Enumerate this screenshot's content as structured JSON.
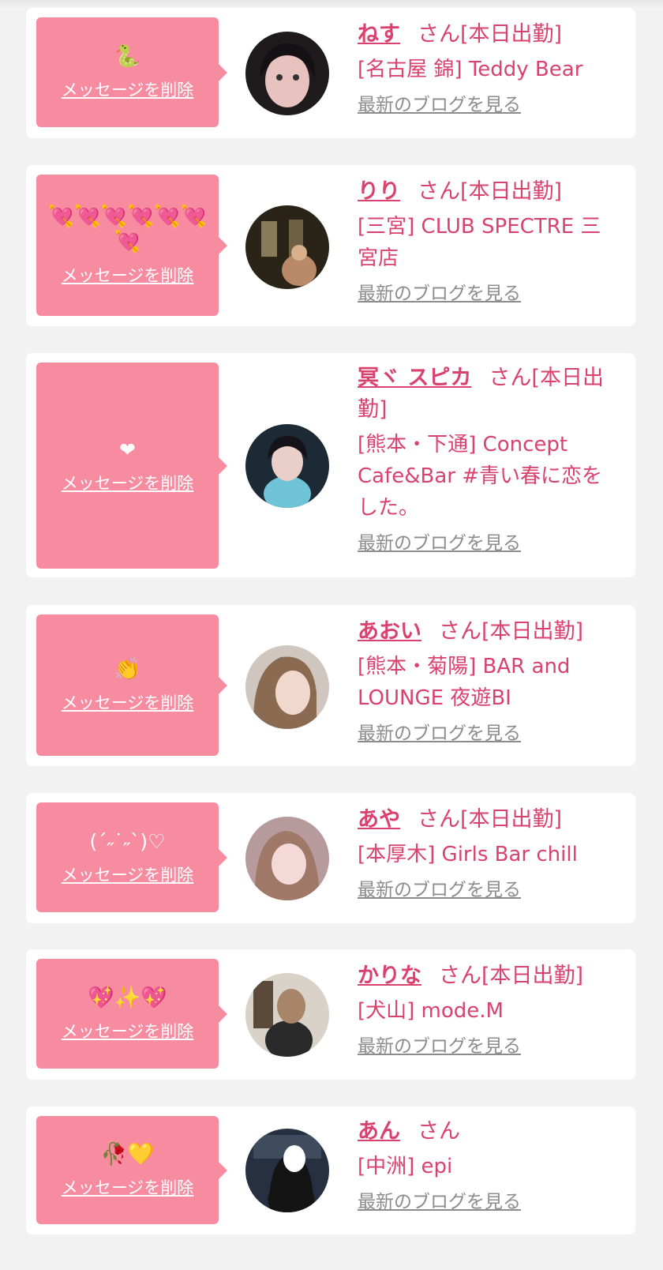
{
  "delete_label": "メッセージを削除",
  "blog_label": "最新のブログを見る",
  "colors": {
    "accent": "#d9426e",
    "bubble": "#f78ba0",
    "blog": "#8c8c8c",
    "background": "#f2f2f2"
  },
  "entries": [
    {
      "message": "🐍",
      "name": "ねす",
      "suffix": "さん[本日出勤]",
      "shop": "[名古屋 錦] Teddy Bear"
    },
    {
      "message": "💘💘💘💘💘💘💘",
      "name": "りり",
      "suffix": "さん[本日出勤]",
      "shop": "[三宮] CLUB SPECTRE 三宮店"
    },
    {
      "message": "❤",
      "name": "冥ヾ スピカ",
      "suffix": "さん[本日出勤]",
      "shop": "[熊本・下通] Concept Cafe&Bar #青い春に恋をした。"
    },
    {
      "message": "👏",
      "name": "あおい",
      "suffix": "さん[本日出勤]",
      "shop": "[熊本・菊陽] BAR and LOUNGE 夜遊BI"
    },
    {
      "message": "(ˊ˶˙˶ˋ)♡",
      "name": "あや",
      "suffix": "さん[本日出勤]",
      "shop": "[本厚木] Girls Bar chill"
    },
    {
      "message": "💖✨💖",
      "name": "かりな",
      "suffix": "さん[本日出勤]",
      "shop": "[犬山] mode.M"
    },
    {
      "message": "🥀💛",
      "name": "あん",
      "suffix": "さん",
      "shop": "[中洲] epi"
    }
  ]
}
